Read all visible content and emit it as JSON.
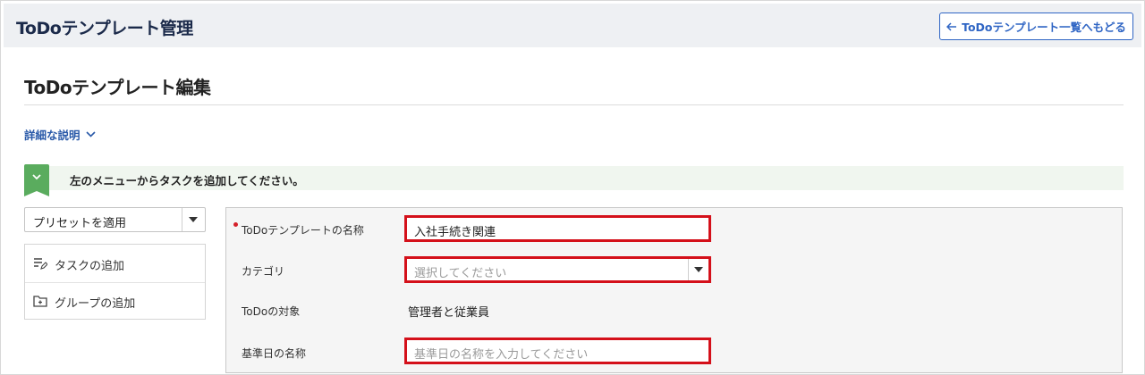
{
  "header": {
    "app_title": "ToDoテンプレート管理",
    "back_button": "ToDoテンプレート一覧へもどる"
  },
  "page": {
    "title": "ToDoテンプレート編集",
    "details_toggle": "詳細な説明"
  },
  "banner": {
    "message": "左のメニューからタスクを追加してください。",
    "accent_color": "#5aac5e"
  },
  "sidebar": {
    "preset_select": {
      "value": "プリセットを適用"
    },
    "items": [
      {
        "label": "タスクの追加",
        "icon": "list-edit-icon"
      },
      {
        "label": "グループの追加",
        "icon": "folder-plus-icon"
      }
    ]
  },
  "form": {
    "rows": [
      {
        "label": "ToDoテンプレートの名称",
        "required": true,
        "value": "入社手続き関連",
        "type": "text"
      },
      {
        "label": "カテゴリ",
        "placeholder": "選択してください",
        "type": "select"
      },
      {
        "label": "ToDoの対象",
        "value": "管理者と従業員",
        "type": "static"
      },
      {
        "label": "基準日の名称",
        "placeholder": "基準日の名称を入力してください",
        "type": "text"
      }
    ],
    "highlight_color": "#d4101a"
  }
}
